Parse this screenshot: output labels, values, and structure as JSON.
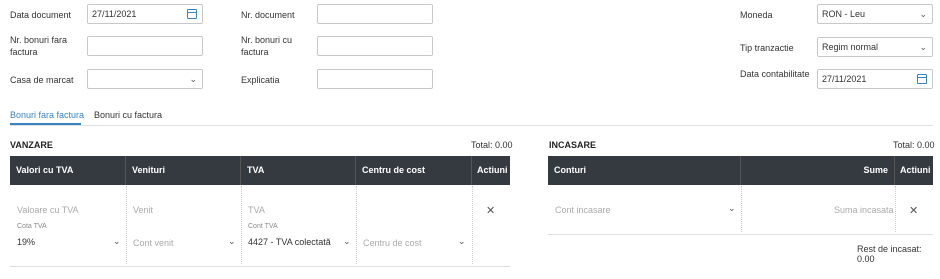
{
  "form": {
    "data_document": {
      "label": "Data document",
      "value": "27/11/2021"
    },
    "nr_document": {
      "label": "Nr. document",
      "value": ""
    },
    "moneda": {
      "label": "Moneda",
      "value": "RON - Leu"
    },
    "nr_bonuri_fara": {
      "label": "Nr. bonuri fara factura",
      "value": ""
    },
    "nr_bonuri_cu": {
      "label": "Nr. bonuri cu factura",
      "value": ""
    },
    "tip_tranzactie": {
      "label": "Tip tranzactie",
      "value": "Regim normal"
    },
    "casa_de_marcat": {
      "label": "Casa de marcat",
      "value": ""
    },
    "explicatia": {
      "label": "Explicatia",
      "value": ""
    },
    "data_contabilitate": {
      "label": "Data contabilitate",
      "value": "27/11/2021"
    }
  },
  "tabs": [
    {
      "label": "Bonuri fara factura",
      "active": true
    },
    {
      "label": "Bonuri cu factura",
      "active": false
    }
  ],
  "vanzare": {
    "title": "VANZARE",
    "total": "Total: 0.00",
    "columns": [
      "Valori cu TVA",
      "Venituri",
      "TVA",
      "Centru de cost",
      "Actiuni"
    ],
    "row": {
      "valoare_placeholder": "Valoare cu TVA",
      "cota_label": "Cota TVA",
      "cota_value": "19%",
      "venit_placeholder": "Venit",
      "cont_venit_placeholder": "Cont venit",
      "tva_placeholder": "TVA",
      "cont_tva_label": "Cont TVA",
      "cont_tva_value": "4427 - TVA colectată",
      "centru_placeholder": "Centru de cost"
    }
  },
  "incasare": {
    "title": "INCASARE",
    "total": "Total: 0.00",
    "columns": [
      "Conturi",
      "Sume",
      "Actiuni"
    ],
    "row": {
      "cont_placeholder": "Cont incasare",
      "suma_placeholder": "Suma incasata"
    },
    "rest": "Rest de incasat: 0.00"
  },
  "colors": {
    "accent": "#3a84c4",
    "header_bg": "#343a40"
  }
}
